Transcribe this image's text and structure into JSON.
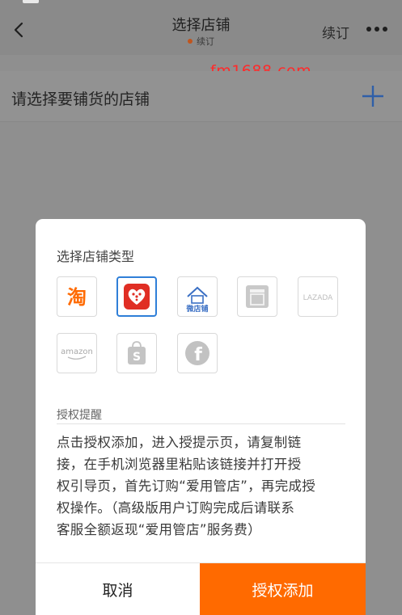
{
  "nav": {
    "title": "选择店铺",
    "subtitle": "续订",
    "renew_label": "续订",
    "more_icon": "more-icon",
    "back_icon": "chevron-left-icon"
  },
  "watermark": "fm1688.com",
  "section": {
    "title": "请选择要铺货的店铺",
    "add_icon": "plus-icon"
  },
  "modal": {
    "title": "选择店铺类型",
    "store_types": [
      {
        "name": "taobao",
        "label": "淘",
        "selected": false
      },
      {
        "name": "pinduoduo",
        "label": "",
        "selected": true
      },
      {
        "name": "weidian",
        "label": "微店铺",
        "selected": false
      },
      {
        "name": "generic-store",
        "label": "",
        "selected": false
      },
      {
        "name": "lazada",
        "label": "LAZADA",
        "selected": false
      },
      {
        "name": "amazon",
        "label": "amazon",
        "selected": false
      },
      {
        "name": "shopee",
        "label": "S",
        "selected": false
      },
      {
        "name": "facebook",
        "label": "f",
        "selected": false
      }
    ],
    "auth_heading": "授权提醒",
    "auth_text": [
      "点击授权添加，进入授提示页，请复制链",
      "接，在手机浏览器里粘贴该链接并打开授",
      "权引导页，首先订购“爱用管店”，再完成授",
      "权操作。（高级版用户订购完成后请联系",
      "客服全额返现“爱用管店”服务费）"
    ],
    "cancel_label": "取消",
    "confirm_label": "授权添加"
  },
  "colors": {
    "accent": "#ff6a00",
    "selected_border": "#2f7fd8",
    "watermark": "#ff2a2a",
    "overlay": "#8f8f8f"
  }
}
